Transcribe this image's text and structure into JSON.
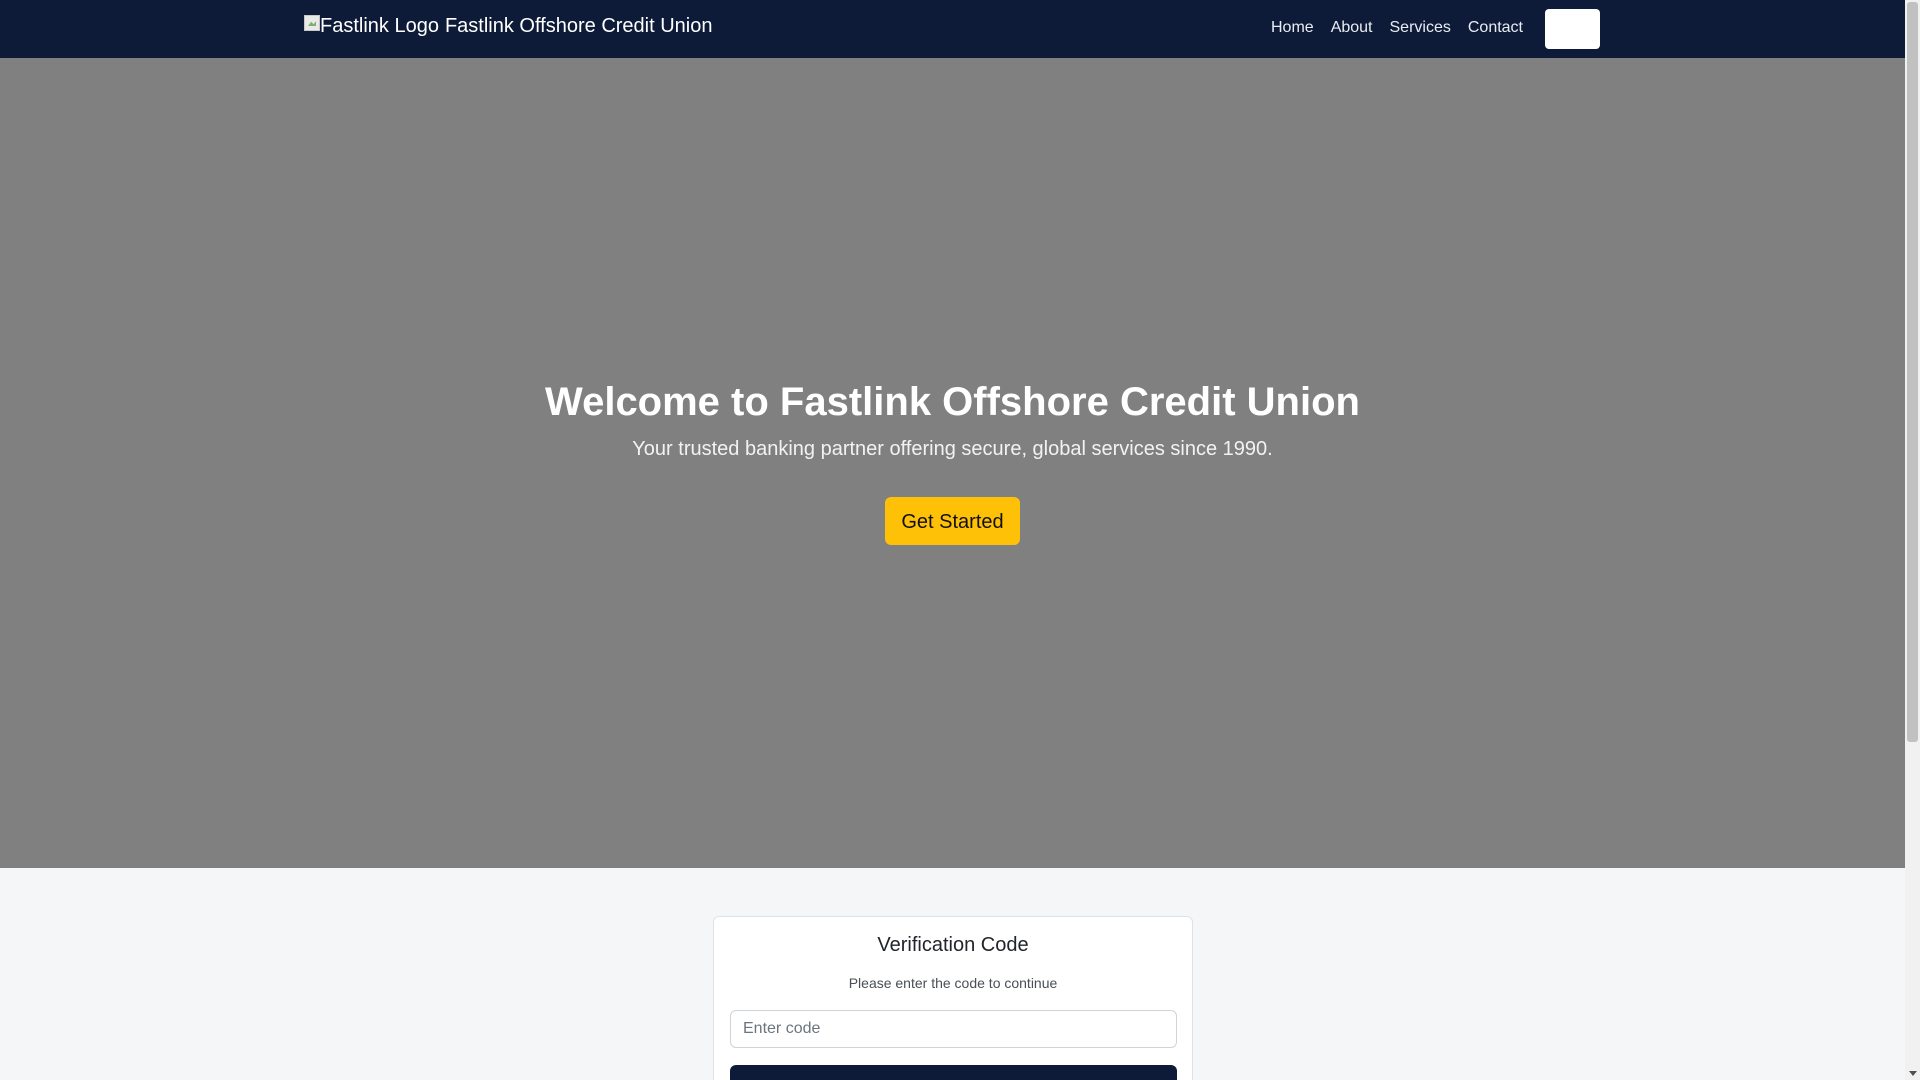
{
  "navbar": {
    "logo_alt": "Fastlink Logo",
    "brand_name": "Fastlink Offshore Credit Union",
    "links": [
      "Home",
      "About",
      "Services",
      "Contact"
    ],
    "button_label": ""
  },
  "hero": {
    "title": "Welcome to Fastlink Offshore Credit Union",
    "subtitle": "Your trusted banking partner offering secure, global services since 1990.",
    "cta_label": "Get Started"
  },
  "verification": {
    "title": "Verification Code",
    "subtitle": "Please enter the code to continue",
    "input_placeholder": "Enter code",
    "input_value": ""
  },
  "colors": {
    "navbar_bg": "#0d1b38",
    "hero_bg": "#808080",
    "cta_bg": "#ffc107",
    "page_bg": "#f5f6f8"
  }
}
